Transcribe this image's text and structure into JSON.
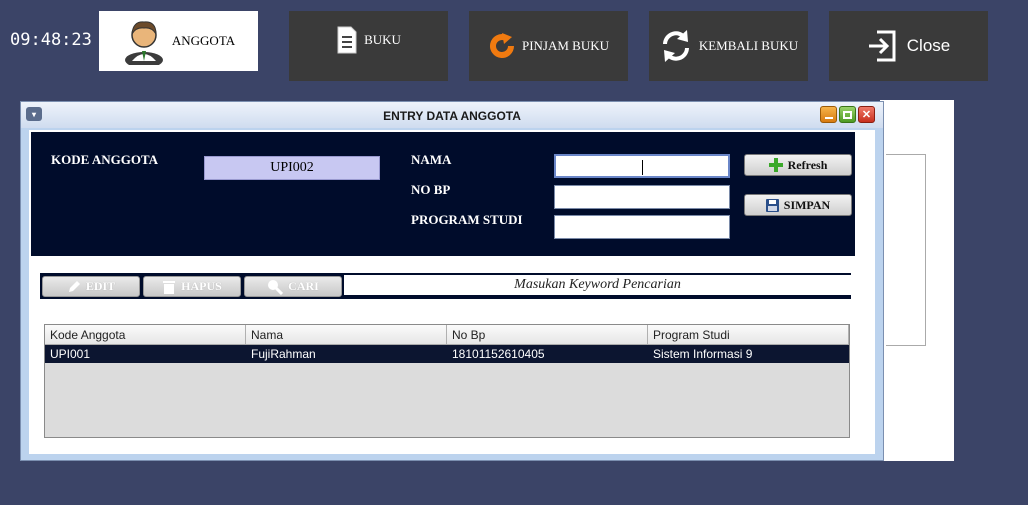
{
  "clock": "09:48:23",
  "topnav": [
    {
      "label": "ANGGOTA",
      "icon": "user-icon"
    },
    {
      "label": "BUKU",
      "icon": "document-icon"
    },
    {
      "label": "PINJAM BUKU",
      "icon": "refresh-arrow-icon"
    },
    {
      "label": "KEMBALI BUKU",
      "icon": "swap-arrows-icon"
    },
    {
      "label": "Close",
      "icon": "exit-icon"
    }
  ],
  "window": {
    "title": "ENTRY DATA ANGGOTA"
  },
  "form": {
    "kode_label": "KODE ANGGOTA",
    "kode_value": "UPI002",
    "nama_label": "NAMA",
    "nama_value": "",
    "nobp_label": "NO BP",
    "nobp_value": "",
    "prodi_label": "PROGRAM STUDI",
    "prodi_value": "",
    "refresh_label": "Refresh",
    "simpan_label": "SIMPAN"
  },
  "toolbar": {
    "edit_label": "EDIT",
    "hapus_label": "HAPUS",
    "cari_label": "CARI",
    "search_placeholder": "Masukan Keyword Pencarian"
  },
  "table": {
    "headers": [
      "Kode Anggota",
      "Nama",
      "No Bp",
      "Program Studi"
    ],
    "rows": [
      [
        "UPI001",
        "FujiRahman",
        "18101152610405",
        "Sistem Informasi 9"
      ]
    ]
  }
}
